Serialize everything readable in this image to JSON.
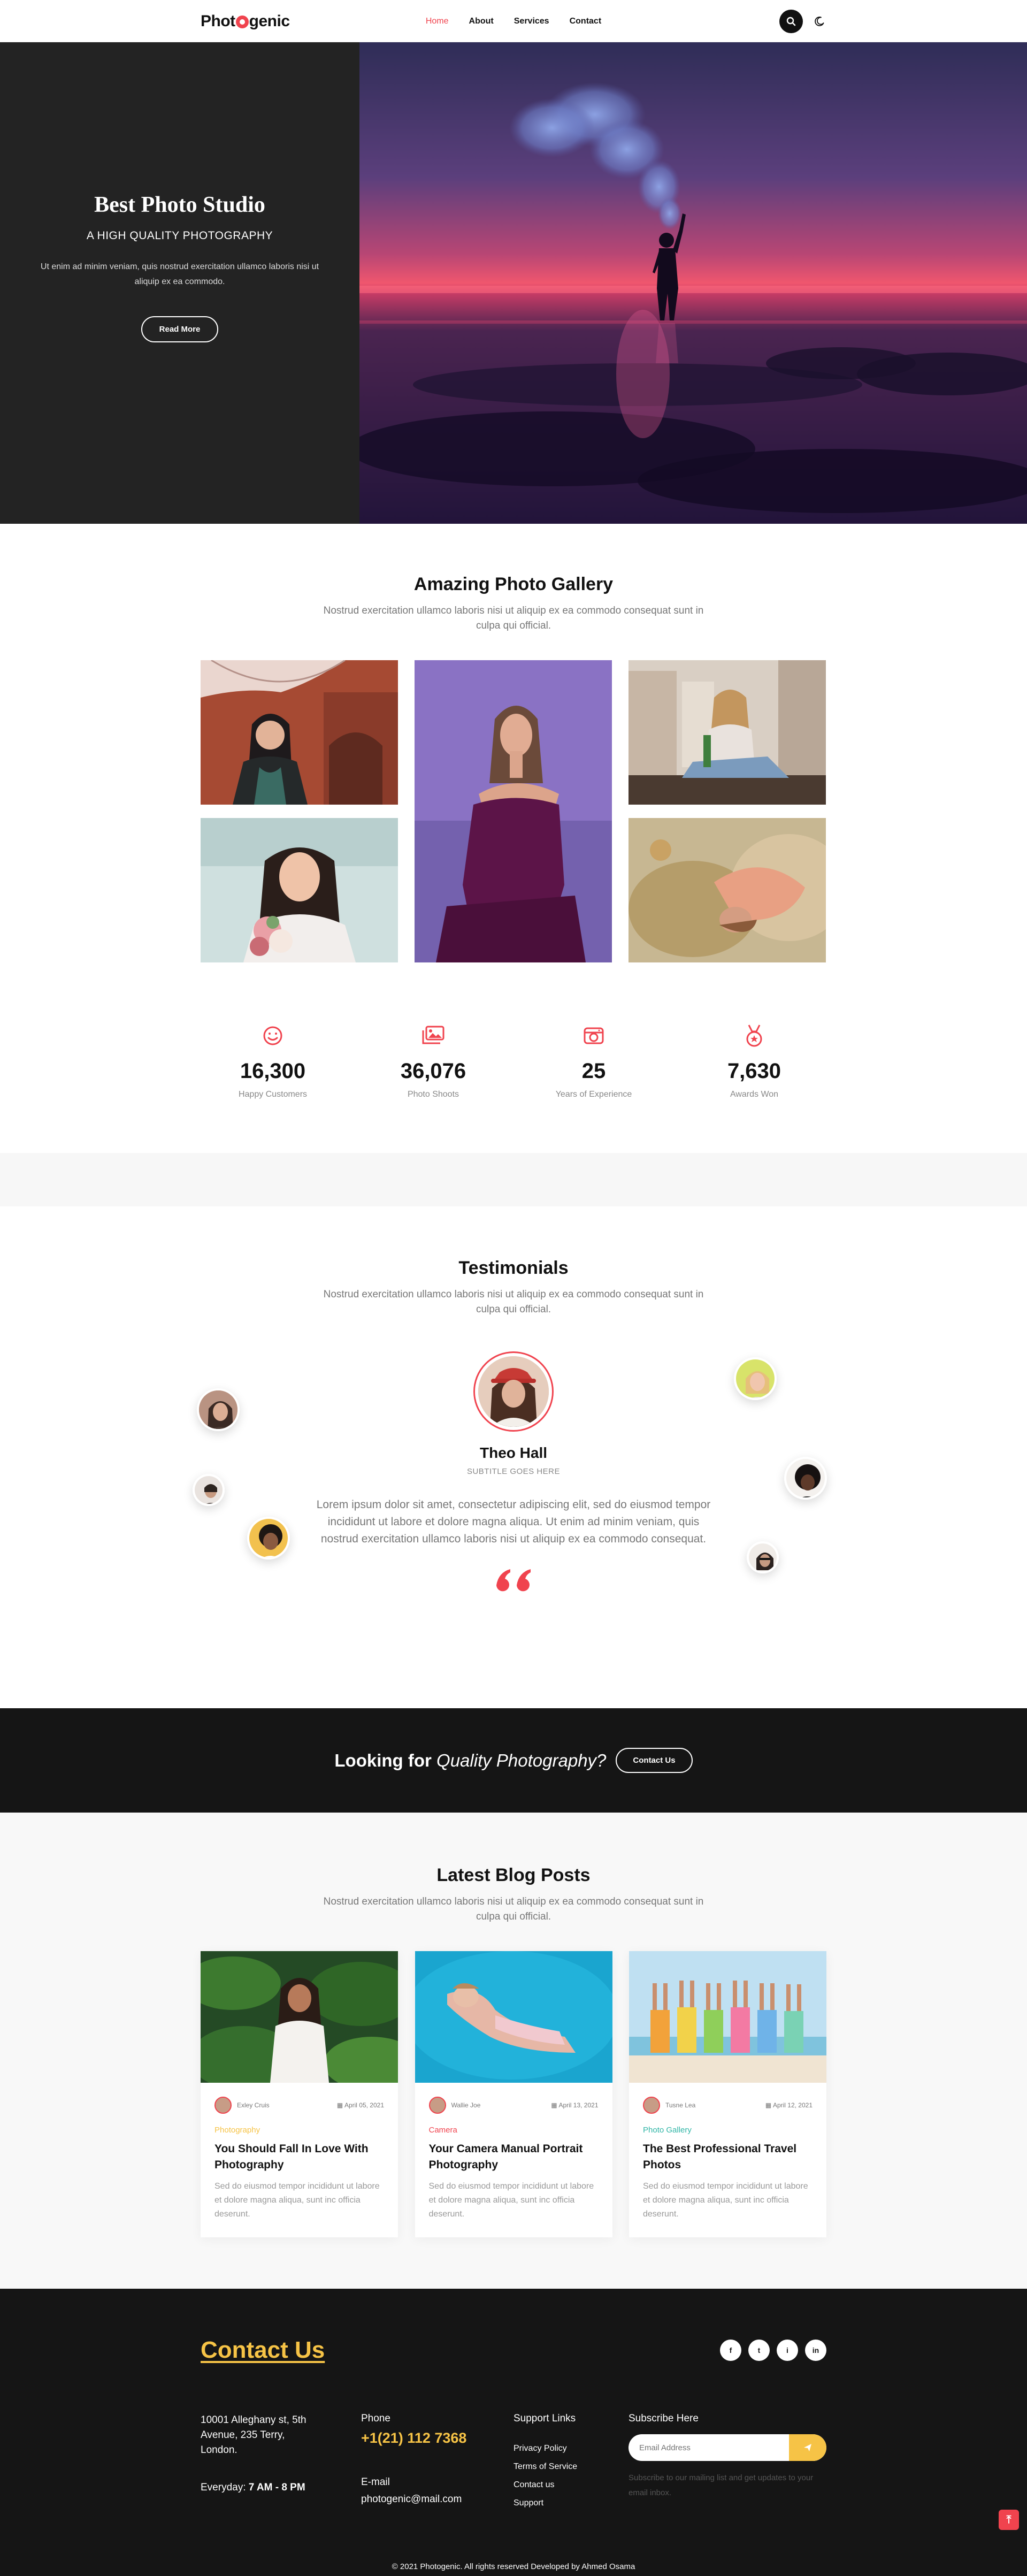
{
  "brand": {
    "logo_before": "Phot",
    "logo_after": "genic"
  },
  "nav": {
    "items": [
      "Home",
      "About",
      "Services",
      "Contact"
    ]
  },
  "hero": {
    "title": "Best Photo Studio",
    "subtitle": "A HIGH QUALITY PHOTOGRAPHY",
    "text": "Ut enim ad minim veniam, quis nostrud exercitation ullamco laboris nisi ut aliquip ex ea commodo.",
    "button": "Read More"
  },
  "gallery": {
    "title": "Amazing Photo Gallery",
    "desc": "Nostrud exercitation ullamco laboris nisi ut aliquip ex ea commodo consequat sunt in culpa qui official."
  },
  "stats": [
    {
      "num": "16,300",
      "label": "Happy Customers",
      "icon": "smile-icon"
    },
    {
      "num": "36,076",
      "label": "Photo Shoots",
      "icon": "images-icon"
    },
    {
      "num": "25",
      "label": "Years of Experience",
      "icon": "camera-icon"
    },
    {
      "num": "7,630",
      "label": "Awards Won",
      "icon": "medal-icon"
    }
  ],
  "testimonials": {
    "title": "Testimonials",
    "desc": "Nostrud exercitation ullamco laboris nisi ut aliquip ex ea commodo consequat sunt in culpa qui official.",
    "name": "Theo Hall",
    "subtitle": "SUBTITLE GOES HERE",
    "text": "Lorem ipsum dolor sit amet, consectetur adipiscing elit, sed do eiusmod tempor incididunt ut labore et dolore magna aliqua. Ut enim ad minim veniam, quis nostrud exercitation ullamco laboris nisi ut aliquip ex ea commodo consequat."
  },
  "cta": {
    "bold": "Looking for",
    "italic": "Quality Photography?",
    "button": "Contact Us"
  },
  "blog": {
    "title": "Latest Blog Posts",
    "desc": "Nostrud exercitation ullamco laboris nisi ut aliquip ex ea commodo consequat sunt in culpa qui official.",
    "posts": [
      {
        "author": "Exley Cruis",
        "date": "April 05, 2021",
        "category": "Photography",
        "cat_color": "#f6c346",
        "title": "You Should Fall In Love With Photography",
        "text": "Sed do eiusmod tempor incididunt ut labore et dolore magna aliqua, sunt inc officia deserunt."
      },
      {
        "author": "Wallie Joe",
        "date": "April 13, 2021",
        "category": "Camera",
        "cat_color": "#f0434e",
        "title": "Your Camera Manual Portrait Photography",
        "text": "Sed do eiusmod tempor incididunt ut labore et dolore magna aliqua, sunt inc officia deserunt."
      },
      {
        "author": "Tusne Lea",
        "date": "April 12, 2021",
        "category": "Photo Gallery",
        "cat_color": "#2fb5a6",
        "title": "The Best Professional Travel Photos",
        "text": "Sed do eiusmod tempor incididunt ut labore et dolore magna aliqua, sunt inc officia deserunt."
      }
    ]
  },
  "footer": {
    "contact_title": "Contact Us",
    "socials": [
      "f",
      "t",
      "i",
      "in"
    ],
    "address": "10001 Alleghany st, 5th Avenue, 235 Terry, London.",
    "hours_label": "Everyday:",
    "hours": "7 AM - 8 PM",
    "phone_label": "Phone",
    "phone": "+1(21) 112 7368",
    "email_label": "E-mail",
    "email": "photogenic@mail.com",
    "support_title": "Support Links",
    "support_links": [
      "Privacy Policy",
      "Terms of Service",
      "Contact us",
      "Support"
    ],
    "subscribe_title": "Subscribe Here",
    "email_placeholder": "Email Address",
    "subscribe_note": "Subscribe to our mailing list and get updates to your email inbox.",
    "copyright": "© 2021 Photogenic. All rights reserved Developed by Ahmed Osama",
    "to_top": "⤒"
  },
  "colors": {
    "accent": "#f0434e",
    "yellow": "#f6c346",
    "dark": "#151515"
  }
}
